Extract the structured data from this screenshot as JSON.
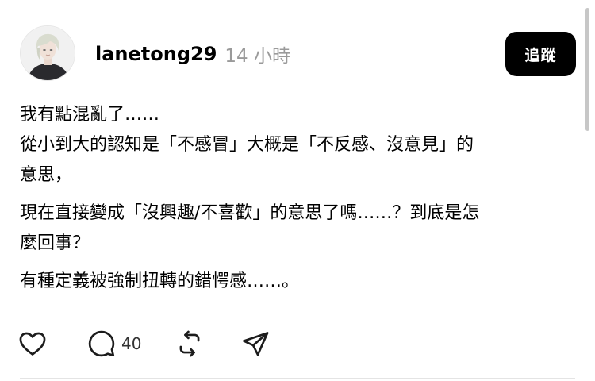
{
  "post": {
    "username": "lanetong29",
    "time": "14 小時",
    "follow_label": "追蹤",
    "paragraphs": [
      {
        "lines": [
          "我有點混亂了……",
          "從小到大的認知是「不感冒」大概是「不反感、沒意見」的",
          "意思，"
        ]
      },
      {
        "lines": [
          "現在直接變成「沒興趣/不喜歡」的意思了嗎……？到底是怎",
          "麼回事？"
        ]
      },
      {
        "lines": [
          "有種定義被強制扭轉的錯愕感……。"
        ]
      }
    ],
    "actions": {
      "like_icon": "heart-icon",
      "reply_icon": "comment-icon",
      "reply_count": "40",
      "repost_icon": "repost-icon",
      "share_icon": "send-icon"
    }
  },
  "colors": {
    "text": "#000000",
    "muted": "#9a9a9a",
    "button_bg": "#000000",
    "button_text": "#ffffff",
    "divider": "#e4e4e4"
  }
}
